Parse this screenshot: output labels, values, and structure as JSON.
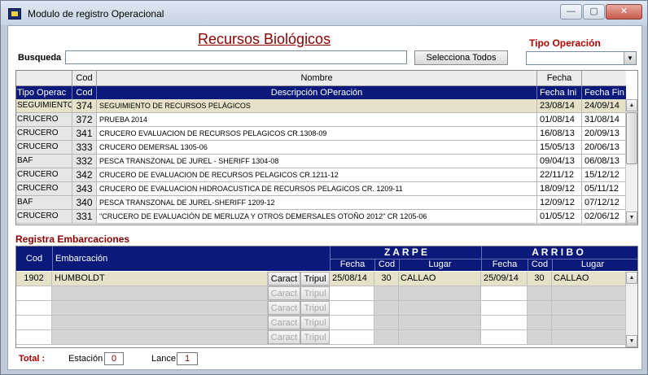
{
  "window": {
    "title": "Modulo de registro Operacional",
    "buttons": {
      "minimize": "—",
      "maximize": "▢",
      "close": "✕"
    }
  },
  "header": {
    "title": "Recursos Biológicos",
    "search_label": "Busqueda",
    "search_value": "",
    "select_all_label": "Selecciona Todos",
    "tipo_operacion_label": "Tipo Operación",
    "tipo_operacion_value": ""
  },
  "operations": {
    "head_top": {
      "cod": "Cod",
      "nombre": "Nombre",
      "fecha": "Fecha"
    },
    "head_bottom": {
      "tipo": "Tipo Operac",
      "cod": "Cod",
      "descripcion": "Descripción OPeración",
      "fecha_ini": "Fecha Ini",
      "fecha_fin": "Fecha Fin"
    },
    "rows": [
      {
        "tipo": "SEGUIMIENTO",
        "cod": "374",
        "nombre": "SEGUIMIENTO DE RECURSOS PELÁGICOS",
        "fecha_ini": "23/08/14",
        "fecha_fin": "24/09/14"
      },
      {
        "tipo": "CRUCERO",
        "cod": "372",
        "nombre": "PRUEBA 2014",
        "fecha_ini": "01/08/14",
        "fecha_fin": "31/08/14"
      },
      {
        "tipo": "CRUCERO",
        "cod": "341",
        "nombre": "CRUCERO EVALUACION DE RECURSOS PELAGICOS CR.1308-09",
        "fecha_ini": "16/08/13",
        "fecha_fin": "20/09/13"
      },
      {
        "tipo": "CRUCERO",
        "cod": "333",
        "nombre": "CRUCERO DEMERSAL 1305-06",
        "fecha_ini": "15/05/13",
        "fecha_fin": "20/06/13"
      },
      {
        "tipo": "BAF",
        "cod": "332",
        "nombre": "PESCA TRANSZONAL DE JUREL - SHERIFF 1304-08",
        "fecha_ini": "09/04/13",
        "fecha_fin": "06/08/13"
      },
      {
        "tipo": "CRUCERO",
        "cod": "342",
        "nombre": "CRUCERO DE EVALUACION DE RECURSOS PELAGICOS CR.1211-12",
        "fecha_ini": "22/11/12",
        "fecha_fin": "15/12/12"
      },
      {
        "tipo": "CRUCERO",
        "cod": "343",
        "nombre": "CRUCERO DE EVALUACION HIDROACUSTICA DE RECURSOS PELAGICOS CR. 1209-11",
        "fecha_ini": "18/09/12",
        "fecha_fin": "05/11/12"
      },
      {
        "tipo": "BAF",
        "cod": "340",
        "nombre": "PESCA TRANSZONAL DE JUREL-SHERIFF 1209-12",
        "fecha_ini": "12/09/12",
        "fecha_fin": "07/12/12"
      },
      {
        "tipo": "CRUCERO",
        "cod": "331",
        "nombre": "\"CRUCERO DE EVALUACIÓN DE MERLUZA Y OTROS DEMERSALES OTOÑO 2012\" CR 1205-06",
        "fecha_ini": "01/05/12",
        "fecha_fin": "02/06/12"
      }
    ]
  },
  "embarcaciones": {
    "section_title": "Registra Embarcaciones",
    "head": {
      "cod": "Cod",
      "embarcacion": "Embarcación",
      "zarpe": "Z A R P E",
      "arribo": "A R R I B O",
      "fecha": "Fecha",
      "cod_sub": "Cod",
      "lugar": "Lugar"
    },
    "caract_label": "Caract",
    "tripul_label": "Tripul",
    "rows": [
      {
        "cod": "1902",
        "embarcacion": "HUMBOLDT",
        "zarpe_fecha": "25/08/14",
        "zarpe_cod": "30",
        "zarpe_lugar": "CALLAO",
        "arribo_fecha": "25/09/14",
        "arribo_cod": "30",
        "arribo_lugar": "CALLAO"
      }
    ]
  },
  "footer": {
    "total_label": "Total :",
    "estacion_label": "Estación",
    "estacion_value": "0",
    "lance_label": "Lance",
    "lance_value": "1"
  }
}
